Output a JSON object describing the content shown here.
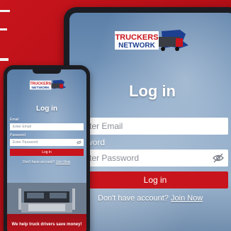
{
  "logo": {
    "line1": "TRUCKERS",
    "line2": "NETWORK"
  },
  "login": {
    "title": "Log in",
    "email_label": "Email",
    "email_placeholder": "Enter Email",
    "password_label": "Password",
    "password_placeholder": "Enter Password",
    "button_label": "Log in",
    "account_prompt": "Don't have account?",
    "join_link": "Join Now"
  },
  "tablet_visible": {
    "email_label": "ail",
    "email_placeholder": "ter Email",
    "password_label": "sword",
    "password_placeholder": "ter Password"
  },
  "phone": {
    "banner": "We help truck drivers save money!"
  },
  "colors": {
    "brand_red": "#c8141c",
    "sky_blue": "#7d9dc0",
    "device_frame": "#1b1d22"
  }
}
